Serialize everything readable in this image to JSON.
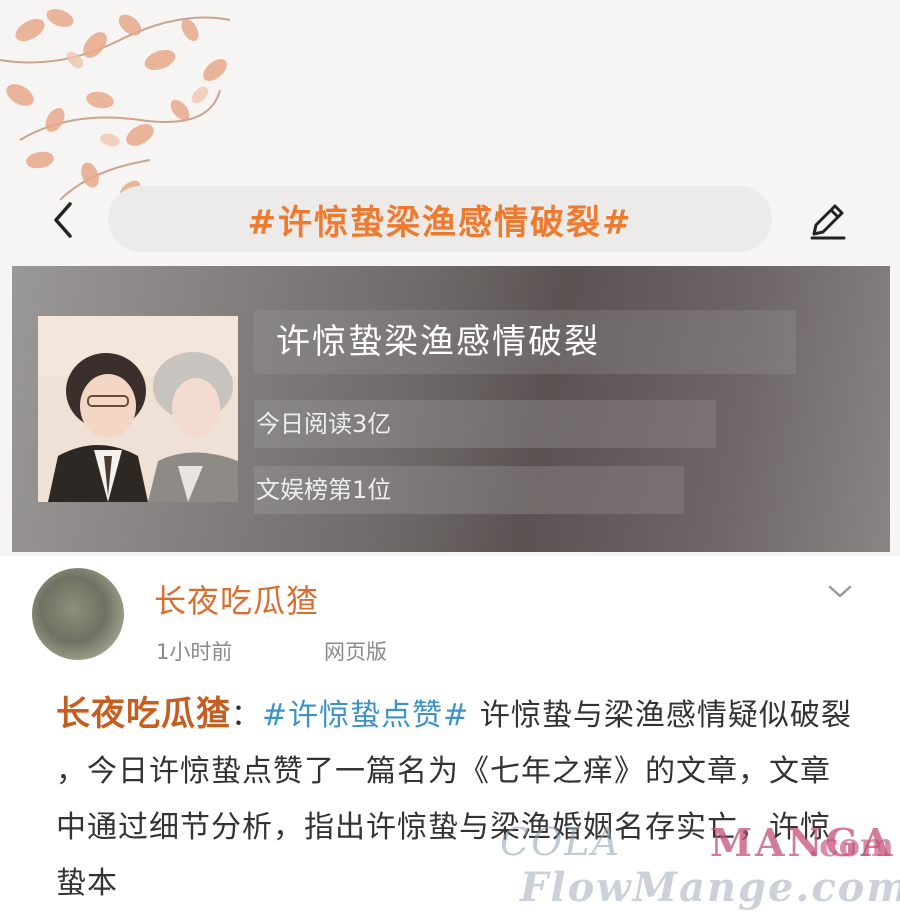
{
  "header": {
    "topic_title": "#许惊蛰梁渔感情破裂#",
    "back_icon": "chevron-left-icon",
    "edit_icon": "pencil-icon"
  },
  "topic_card": {
    "name": "许惊蛰梁渔感情破裂",
    "reads": "今日阅读3亿",
    "rank": "文娱榜第1位"
  },
  "post": {
    "author": "长夜吃瓜猹",
    "time": "1小时前",
    "source": "网页版",
    "author_ref": "长夜吃瓜猹",
    "colon": "：",
    "hashtag": "#许惊蛰点赞#",
    "text": " 许惊蛰与梁渔感情疑似破裂 ，今日许惊蛰点赞了一篇名为《七年之痒》的文章，文章中通过细节分析，指出许惊蛰与梁渔婚姻名存实亡，许惊蛰本"
  },
  "watermark": {
    "part1": "COLA",
    "part2": "MANGA",
    "part3": ".com",
    "part4": "FlowMange.com"
  },
  "colors": {
    "accent": "#ee7a2e",
    "author": "#d86f32",
    "hashtag": "#3d93c7",
    "card_bg": "#6f6a69"
  }
}
